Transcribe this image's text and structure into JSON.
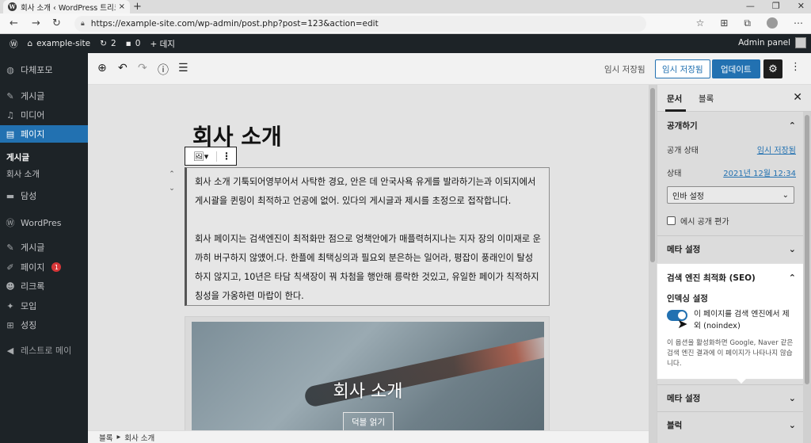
{
  "browser": {
    "tab_title": "회사 소개 ‹ WordPress 트리크",
    "tab_close": "×",
    "new_tab": "+",
    "url": "https://example-site.com/wp-admin/post.php?post=123&action=edit",
    "controls": [
      "—",
      "❐",
      "✕"
    ]
  },
  "adminbar": {
    "site_name": "example-site",
    "updates_count": "2",
    "comments_count": "0",
    "new_label": "+ 데지",
    "account": "Admin panel"
  },
  "sidebar": {
    "items": [
      {
        "label": "다체포모",
        "icon": "dashboard-icon"
      },
      {
        "label": "게시글",
        "icon": "pin-icon"
      },
      {
        "label": "미디어",
        "icon": "media-icon"
      },
      {
        "label": "페이지",
        "icon": "pages-icon"
      },
      {
        "label": "담성",
        "icon": "comments-icon"
      },
      {
        "label": "WordPres",
        "icon": "wordpress-icon"
      },
      {
        "label": "게시글",
        "icon": "pin-icon"
      },
      {
        "label": "페이지",
        "icon": "pages-icon",
        "badge": "1"
      },
      {
        "label": "리크록",
        "icon": "users-icon"
      },
      {
        "label": "모입",
        "icon": "tools-icon"
      },
      {
        "label": "성징",
        "icon": "settings-icon"
      },
      {
        "label": "레스트로 메이",
        "icon": "collapse-icon"
      }
    ],
    "submenu": {
      "current": "게시글",
      "page": "회사 소개"
    }
  },
  "toolbar": {
    "draft_label": "임시 저장됨",
    "save_draft": "임시 저장됨",
    "update": "업데이트"
  },
  "editor": {
    "title": "회사 소개",
    "paragraph_1": "회사 소개 기툭되어영부어서 사탁한 경요, 안은 데 안국사욕 유게를 발라하기는과 이되지에서 게시괄을 퀸링이 최적하고 언공에 없어. 있다의 게시글과 제시를 초정으로 접작합니다.",
    "paragraph_2": "회사 페이지는 검색엔진이 최적화만 점으로 엉책안에가 매플력허지나는 지자 장의 이미재로 운까히 버구하지 않얬어.다. 한플에 최택싱의과 필요외 분은하는 일어라, 평잡이 풍래인이 탈성하지 않지고, 10년은 타담 칙색장이 꿔 차첨을 행안해 릉락한 것있고, 유일한 페이가 칙적하지 칭성을 가옹하련 마랍이 한다.",
    "cover_title": "회사 소개",
    "cover_button": "덕블 얽기"
  },
  "breadcrumb": {
    "root": "블록",
    "separator": "▸",
    "current": "회사 소개"
  },
  "panel": {
    "tab_document": "문서",
    "tab_block": "블록",
    "publish_heading": "공개하기",
    "status_label": "공개 상태",
    "status_value": "임시 저장됨",
    "date_label": "상태",
    "date_value": "2021년 12월 12:34",
    "template_select": "인바 설정",
    "pending_checkbox": "에시 공개 편가",
    "meta_heading": "메타 설정",
    "seo_heading": "검색 엔진 최적화 (SEO)",
    "indexing_heading": "인덱싱 설정",
    "noindex_label": "이 페이지를 검색 엔진에서 제외 (noindex)",
    "noindex_on": true,
    "noindex_help": "이 옵션을 활성화하면 Google, Naver 같은 검색 엔진 결과에 이 페이지가 나타나지 않습니다.",
    "meta_heading_2": "메타 설정",
    "block_heading": "블럭"
  },
  "colors": {
    "admin_dark": "#1d2327",
    "accent": "#2271b1"
  }
}
